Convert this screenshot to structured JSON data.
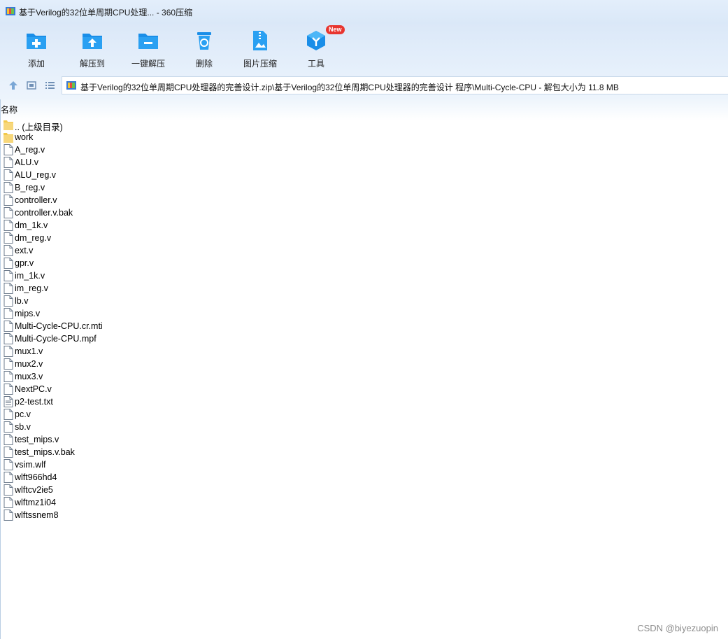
{
  "window": {
    "title": "基于Verilog的32位单周期CPU处理... - 360压缩"
  },
  "toolbar": {
    "buttons": [
      {
        "label": "添加",
        "icon": "add-folder-icon"
      },
      {
        "label": "解压到",
        "icon": "extract-to-icon"
      },
      {
        "label": "一键解压",
        "icon": "one-click-extract-icon"
      },
      {
        "label": "删除",
        "icon": "trash-icon"
      },
      {
        "label": "图片压缩",
        "icon": "image-compress-icon"
      },
      {
        "label": "工具",
        "icon": "tools-cube-icon",
        "badge": "New"
      }
    ]
  },
  "address": {
    "path": "基于Verilog的32位单周期CPU处理器的完善设计.zip\\基于Verilog的32位单周期CPU处理器的完善设计 程序\\Multi-Cycle-CPU - 解包大小为 11.8 MB"
  },
  "list": {
    "column_name": "名称",
    "items": [
      {
        "name": ".. (上级目录)",
        "type": "folder"
      },
      {
        "name": "work",
        "type": "folder"
      },
      {
        "name": "A_reg.v",
        "type": "file"
      },
      {
        "name": "ALU.v",
        "type": "file"
      },
      {
        "name": "ALU_reg.v",
        "type": "file"
      },
      {
        "name": "B_reg.v",
        "type": "file"
      },
      {
        "name": "controller.v",
        "type": "file"
      },
      {
        "name": "controller.v.bak",
        "type": "file"
      },
      {
        "name": "dm_1k.v",
        "type": "file"
      },
      {
        "name": "dm_reg.v",
        "type": "file"
      },
      {
        "name": "ext.v",
        "type": "file"
      },
      {
        "name": "gpr.v",
        "type": "file"
      },
      {
        "name": "im_1k.v",
        "type": "file"
      },
      {
        "name": "im_reg.v",
        "type": "file"
      },
      {
        "name": "lb.v",
        "type": "file"
      },
      {
        "name": "mips.v",
        "type": "file"
      },
      {
        "name": "Multi-Cycle-CPU.cr.mti",
        "type": "file"
      },
      {
        "name": "Multi-Cycle-CPU.mpf",
        "type": "file"
      },
      {
        "name": "mux1.v",
        "type": "file"
      },
      {
        "name": "mux2.v",
        "type": "file"
      },
      {
        "name": "mux3.v",
        "type": "file"
      },
      {
        "name": "NextPC.v",
        "type": "file"
      },
      {
        "name": "p2-test.txt",
        "type": "text"
      },
      {
        "name": "pc.v",
        "type": "file"
      },
      {
        "name": "sb.v",
        "type": "file"
      },
      {
        "name": "test_mips.v",
        "type": "file"
      },
      {
        "name": "test_mips.v.bak",
        "type": "file"
      },
      {
        "name": "vsim.wlf",
        "type": "file"
      },
      {
        "name": "wlft966hd4",
        "type": "file"
      },
      {
        "name": "wlftcv2ie5",
        "type": "file"
      },
      {
        "name": "wlftmz1i04",
        "type": "file"
      },
      {
        "name": "wlftssnem8",
        "type": "file"
      }
    ]
  },
  "watermark": "CSDN @biyezuopin",
  "colors": {
    "accent": "#1a8ee8",
    "folder": "#f7d77a",
    "badge": "#e8352f"
  }
}
